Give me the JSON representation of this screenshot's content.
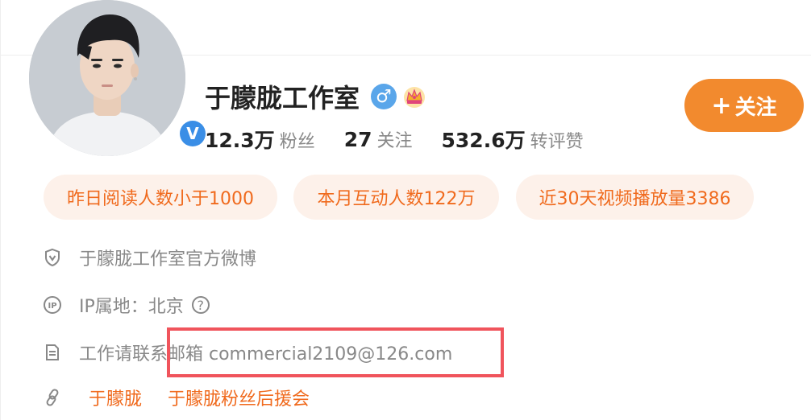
{
  "profile": {
    "name": "于朦胧工作室",
    "gender_icon": "male-symbol",
    "badge_icon": "crown",
    "verified_mark": "V"
  },
  "stats": [
    {
      "num": "12.3万",
      "label": "粉丝"
    },
    {
      "num": "27",
      "label": "关注"
    },
    {
      "num": "532.6万",
      "label": "转评赞"
    }
  ],
  "follow": {
    "plus": "+",
    "label": "关注"
  },
  "tags": [
    "昨日阅读人数小于1000",
    "本月互动人数122万",
    "近30天视频播放量3386"
  ],
  "info": {
    "verified_text": "于朦胧工作室官方微博",
    "ip_label": "IP属地：北京",
    "help_glyph": "?",
    "contact_text": "工作请联系邮箱 commercial2109@126.com",
    "links": [
      "于朦胧",
      "于朦胧粉丝后援会"
    ]
  },
  "colors": {
    "accent": "#f28a2e",
    "tag_text": "#f06a1d",
    "tag_bg": "#fdf1ea",
    "verified": "#3a8ee6",
    "highlight": "#f0545c"
  }
}
